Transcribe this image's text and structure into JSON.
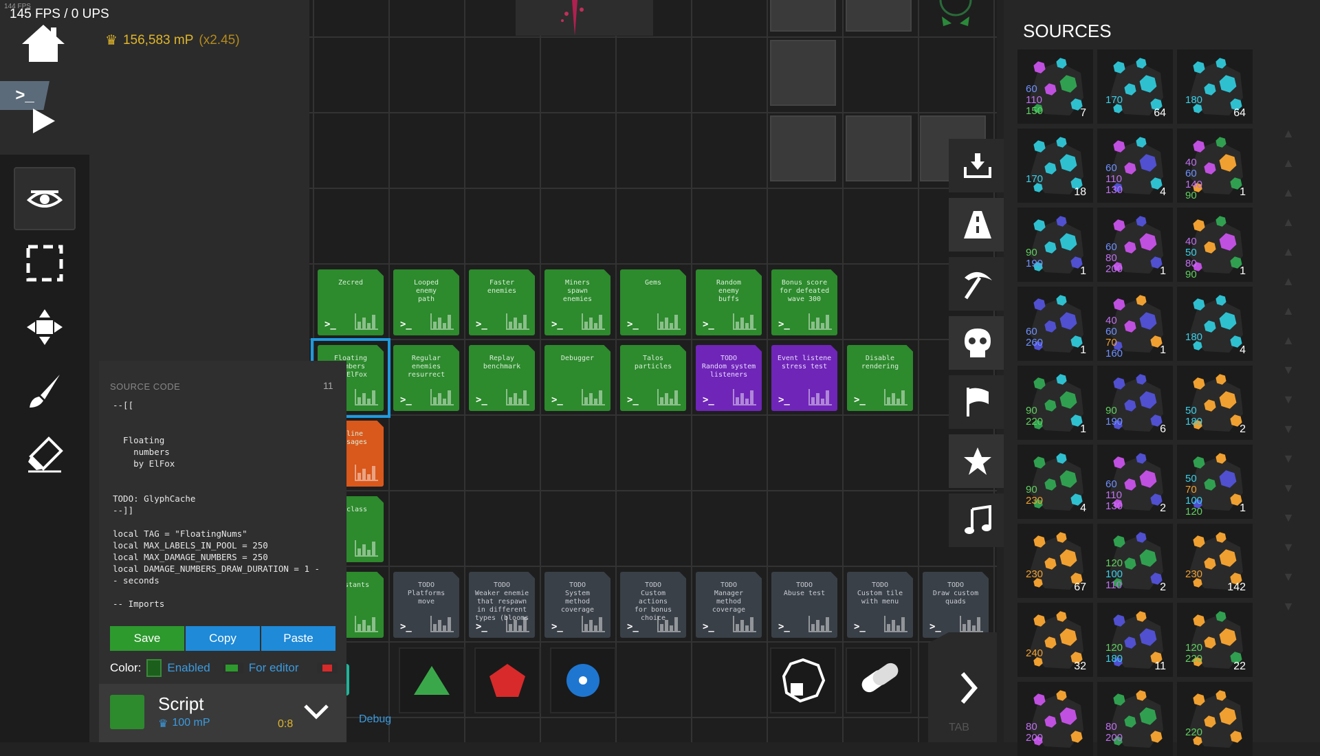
{
  "hud": {
    "tiny_fps": "144 FPS",
    "fps": "145 FPS / 0 UPS",
    "currency": "156,583 mP",
    "multiplier": "(x2.45)",
    "terminal_icon": ">_"
  },
  "tools": [
    "eye-icon",
    "select-rect-icon",
    "move-icon",
    "brush-icon",
    "eraser-icon"
  ],
  "chips": [
    {
      "label": "Zecred",
      "color": "green"
    },
    {
      "label": "Looped\nenemy\npath",
      "color": "green"
    },
    {
      "label": "Faster\nenemies",
      "color": "green"
    },
    {
      "label": "Miners\nspawn\nenemies",
      "color": "green"
    },
    {
      "label": "Gems",
      "color": "green"
    },
    {
      "label": "Random\nenemy\nbuffs",
      "color": "green"
    },
    {
      "label": "Bonus score\nfor defeated\nwave 300",
      "color": "green"
    },
    {
      "label": "Floating\nnumbers\nby ElFox",
      "color": "green"
    },
    {
      "label": "Regular\nenemies\nresurrect",
      "color": "green"
    },
    {
      "label": "Replay\nbenchmark",
      "color": "green"
    },
    {
      "label": "Debugger",
      "color": "green"
    },
    {
      "label": "Talos\nparticles",
      "color": "green"
    },
    {
      "label": "TODO\nRandom system\nlisteners",
      "color": "purple"
    },
    {
      "label": "Event listene\nstress test",
      "color": "purple"
    },
    {
      "label": "Disable\nrendering",
      "color": "green"
    },
    {
      "label": "Inline\nmessages",
      "color": "orange"
    },
    {
      "label": "Subclass",
      "color": "green"
    },
    {
      "label": "Constants",
      "color": "green"
    },
    {
      "label": "TODO\nPlatforms\nmove",
      "color": "dark"
    },
    {
      "label": "TODO\nWeaker enemie\nthat respawn\nin different\ntypes (blooms",
      "color": "dark"
    },
    {
      "label": "TODO\nSystem\nmethod\ncoverage",
      "color": "dark"
    },
    {
      "label": "TODO\nCustom\nactions\nfor bonus\nchoice",
      "color": "dark"
    },
    {
      "label": "TODO\nManager\nmethod\ncoverage",
      "color": "dark"
    },
    {
      "label": "TODO\nAbuse test",
      "color": "dark"
    },
    {
      "label": "TODO\nCustom tile\nwith menu",
      "color": "dark"
    },
    {
      "label": "TODO\nDraw custom\nquads",
      "color": "dark"
    }
  ],
  "categories": [
    "inbox-download-icon",
    "road-icon",
    "pickaxe-icon",
    "skull-icon",
    "flag-icon",
    "star-icon",
    "music-icon"
  ],
  "tab_label": "TAB",
  "sources": {
    "title": "SOURCES",
    "items": [
      {
        "nums": [
          "60",
          "110",
          "150"
        ],
        "count": "7"
      },
      {
        "nums": [
          "170"
        ],
        "count": "64"
      },
      {
        "nums": [
          "180"
        ],
        "count": "64"
      },
      {
        "nums": [
          "170"
        ],
        "count": "18"
      },
      {
        "nums": [
          "60",
          "110",
          "130"
        ],
        "count": "4"
      },
      {
        "nums": [
          "40",
          "60",
          "140",
          "90"
        ],
        "count": "1"
      },
      {
        "nums": [
          "90",
          "190"
        ],
        "count": "1"
      },
      {
        "nums": [
          "60",
          "80",
          "200"
        ],
        "count": "1"
      },
      {
        "nums": [
          "40",
          "50",
          "80",
          "90"
        ],
        "count": "1"
      },
      {
        "nums": [
          "60",
          "260"
        ],
        "count": "1"
      },
      {
        "nums": [
          "40",
          "60",
          "70",
          "160"
        ],
        "count": "1"
      },
      {
        "nums": [
          "180"
        ],
        "count": "4"
      },
      {
        "nums": [
          "90",
          "220"
        ],
        "count": "1"
      },
      {
        "nums": [
          "90",
          "190"
        ],
        "count": "6"
      },
      {
        "nums": [
          "50",
          "180"
        ],
        "count": "2"
      },
      {
        "nums": [
          "90",
          "230"
        ],
        "count": "4"
      },
      {
        "nums": [
          "60",
          "110",
          "130"
        ],
        "count": "2"
      },
      {
        "nums": [
          "50",
          "70",
          "100",
          "120"
        ],
        "count": "1"
      },
      {
        "nums": [
          "230"
        ],
        "count": "67"
      },
      {
        "nums": [
          "120",
          "100",
          "110"
        ],
        "count": "2"
      },
      {
        "nums": [
          "230"
        ],
        "count": "142"
      },
      {
        "nums": [
          "240"
        ],
        "count": "32"
      },
      {
        "nums": [
          "120",
          "180"
        ],
        "count": "11"
      },
      {
        "nums": [
          "120",
          "220"
        ],
        "count": "22"
      },
      {
        "nums": [
          "80",
          "200"
        ],
        "count": ""
      },
      {
        "nums": [
          "80",
          "200"
        ],
        "count": ""
      },
      {
        "nums": [
          "220"
        ],
        "count": ""
      }
    ]
  },
  "code": {
    "header": "SOURCE CODE",
    "tile_badge": "11",
    "text": "--[[\n\n\n  Floating\n    numbers\n    by ElFox\n\n\nTODO: GlyphCache\n--]]\n\nlocal TAG = \"FloatingNums\"\nlocal MAX_LABELS_IN_POOL = 250\nlocal MAX_DAMAGE_NUMBERS = 250\nlocal DAMAGE_NUMBERS_DRAW_DURATION = 1 -\n- seconds\n\n-- Imports",
    "save": "Save",
    "copy": "Copy",
    "paste": "Paste",
    "color_label": "Color:",
    "enabled": "Enabled",
    "for_editor": "For editor",
    "script_title": "Script",
    "script_cost": "100 mP",
    "script_pos": "0:8",
    "debug": "Debug"
  }
}
